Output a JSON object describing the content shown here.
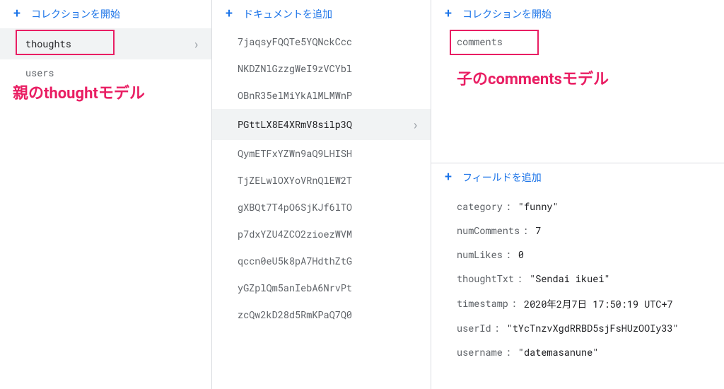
{
  "col1": {
    "action": "コレクションを開始",
    "items": [
      {
        "label": "thoughts",
        "selected": true
      },
      {
        "label": "users",
        "selected": false
      }
    ],
    "annotation": "親のthoughtモデル"
  },
  "col2": {
    "action": "ドキュメントを追加",
    "items": [
      {
        "label": "7jaqsyFQQTe5YQNckCcc",
        "selected": false
      },
      {
        "label": "NKDZNlGzzgWeI9zVCYbl",
        "selected": false
      },
      {
        "label": "OBnR35elMiYkAlMLMWnP",
        "selected": false
      },
      {
        "label": "PGttLX8E4XRmV8silp3Q",
        "selected": true
      },
      {
        "label": "QymETFxYZWn9aQ9LHISH",
        "selected": false
      },
      {
        "label": "TjZELwlOXYoVRnQlEW2T",
        "selected": false
      },
      {
        "label": "gXBQt7T4pO6SjKJf6lTO",
        "selected": false
      },
      {
        "label": "p7dxYZU4ZCO2zioezWVM",
        "selected": false
      },
      {
        "label": "qccn0eU5k8pA7HdthZtG",
        "selected": false
      },
      {
        "label": "yGZplQm5anIebA6NrvPt",
        "selected": false
      },
      {
        "label": "zcQw2kD28d5RmKPaQ7Q0",
        "selected": false
      }
    ]
  },
  "col3": {
    "action_collection": "コレクションを開始",
    "subcollections": [
      {
        "label": "comments"
      }
    ],
    "annotation": "子のcommentsモデル",
    "action_field": "フィールドを追加",
    "fields": [
      {
        "key": "category",
        "value": "\"funny\""
      },
      {
        "key": "numComments",
        "value": "7"
      },
      {
        "key": "numLikes",
        "value": "0"
      },
      {
        "key": "thoughtTxt",
        "value": "\"Sendai ikuei\""
      },
      {
        "key": "timestamp",
        "value": "2020年2月7日 17:50:19 UTC+7"
      },
      {
        "key": "userId",
        "value": "\"tYcTnzvXgdRRBD5sjFsHUzOOIy33\""
      },
      {
        "key": "username",
        "value": "\"datemasanune\""
      }
    ]
  }
}
